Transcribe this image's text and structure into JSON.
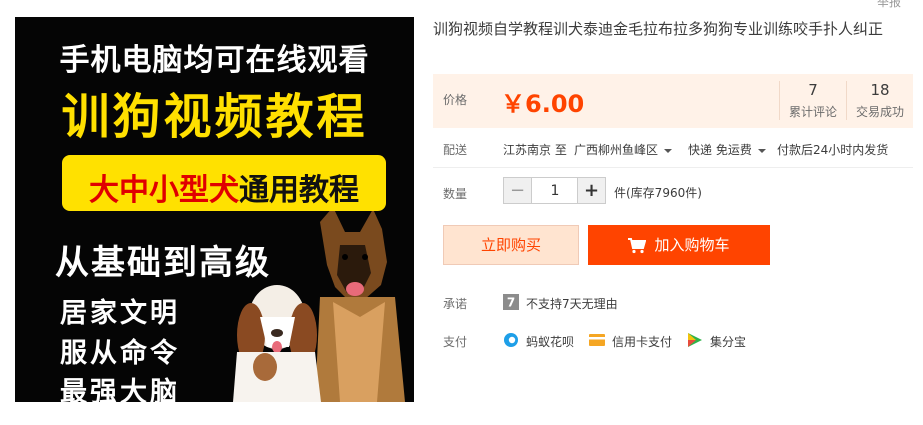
{
  "corner_text": "举报",
  "hero": {
    "line1": "手机电脑均可在线观看",
    "line2": "训狗视频教程",
    "box_red": "大中小型犬",
    "box_black": "通用教程",
    "line4": "从基础到高级",
    "bullets": [
      "居家文明",
      "服从命令",
      "最强大脑"
    ]
  },
  "product": {
    "title": "训狗视频自学教程训犬泰迪金毛拉布拉多狗狗专业训练咬手扑人纠正"
  },
  "price": {
    "label": "价格",
    "value": "￥6.00",
    "reviews_count": "7",
    "reviews_label": "累计评论",
    "deals_count": "18",
    "deals_label": "交易成功"
  },
  "delivery": {
    "label": "配送",
    "from": "江苏南京 至",
    "to": "广西柳州鱼峰区",
    "shipping": "快递 免运费",
    "dispatch": "付款后24小时内发货"
  },
  "quantity": {
    "label": "数量",
    "value": "1",
    "stock": "件(库存7960件)",
    "minus": "−",
    "plus": "+"
  },
  "actions": {
    "buy_now": "立即购买",
    "add_to_cart": "加入购物车"
  },
  "promise": {
    "label": "承诺",
    "text": "不支持7天无理由"
  },
  "payment": {
    "label": "支付",
    "methods": [
      "蚂蚁花呗",
      "信用卡支付",
      "集分宝"
    ]
  },
  "colors": {
    "accent": "#ff4400",
    "price_bg": "#fff2e8",
    "hero_yellow": "#ffe000"
  }
}
